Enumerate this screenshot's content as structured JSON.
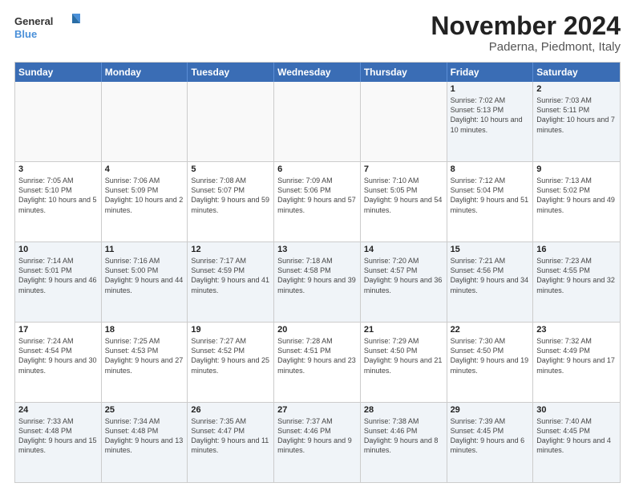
{
  "logo": {
    "line1": "General",
    "line2": "Blue"
  },
  "title": "November 2024",
  "subtitle": "Paderna, Piedmont, Italy",
  "headers": [
    "Sunday",
    "Monday",
    "Tuesday",
    "Wednesday",
    "Thursday",
    "Friday",
    "Saturday"
  ],
  "rows": [
    [
      {
        "day": "",
        "text": ""
      },
      {
        "day": "",
        "text": ""
      },
      {
        "day": "",
        "text": ""
      },
      {
        "day": "",
        "text": ""
      },
      {
        "day": "",
        "text": ""
      },
      {
        "day": "1",
        "text": "Sunrise: 7:02 AM\nSunset: 5:13 PM\nDaylight: 10 hours and 10 minutes."
      },
      {
        "day": "2",
        "text": "Sunrise: 7:03 AM\nSunset: 5:11 PM\nDaylight: 10 hours and 7 minutes."
      }
    ],
    [
      {
        "day": "3",
        "text": "Sunrise: 7:05 AM\nSunset: 5:10 PM\nDaylight: 10 hours and 5 minutes."
      },
      {
        "day": "4",
        "text": "Sunrise: 7:06 AM\nSunset: 5:09 PM\nDaylight: 10 hours and 2 minutes."
      },
      {
        "day": "5",
        "text": "Sunrise: 7:08 AM\nSunset: 5:07 PM\nDaylight: 9 hours and 59 minutes."
      },
      {
        "day": "6",
        "text": "Sunrise: 7:09 AM\nSunset: 5:06 PM\nDaylight: 9 hours and 57 minutes."
      },
      {
        "day": "7",
        "text": "Sunrise: 7:10 AM\nSunset: 5:05 PM\nDaylight: 9 hours and 54 minutes."
      },
      {
        "day": "8",
        "text": "Sunrise: 7:12 AM\nSunset: 5:04 PM\nDaylight: 9 hours and 51 minutes."
      },
      {
        "day": "9",
        "text": "Sunrise: 7:13 AM\nSunset: 5:02 PM\nDaylight: 9 hours and 49 minutes."
      }
    ],
    [
      {
        "day": "10",
        "text": "Sunrise: 7:14 AM\nSunset: 5:01 PM\nDaylight: 9 hours and 46 minutes."
      },
      {
        "day": "11",
        "text": "Sunrise: 7:16 AM\nSunset: 5:00 PM\nDaylight: 9 hours and 44 minutes."
      },
      {
        "day": "12",
        "text": "Sunrise: 7:17 AM\nSunset: 4:59 PM\nDaylight: 9 hours and 41 minutes."
      },
      {
        "day": "13",
        "text": "Sunrise: 7:18 AM\nSunset: 4:58 PM\nDaylight: 9 hours and 39 minutes."
      },
      {
        "day": "14",
        "text": "Sunrise: 7:20 AM\nSunset: 4:57 PM\nDaylight: 9 hours and 36 minutes."
      },
      {
        "day": "15",
        "text": "Sunrise: 7:21 AM\nSunset: 4:56 PM\nDaylight: 9 hours and 34 minutes."
      },
      {
        "day": "16",
        "text": "Sunrise: 7:23 AM\nSunset: 4:55 PM\nDaylight: 9 hours and 32 minutes."
      }
    ],
    [
      {
        "day": "17",
        "text": "Sunrise: 7:24 AM\nSunset: 4:54 PM\nDaylight: 9 hours and 30 minutes."
      },
      {
        "day": "18",
        "text": "Sunrise: 7:25 AM\nSunset: 4:53 PM\nDaylight: 9 hours and 27 minutes."
      },
      {
        "day": "19",
        "text": "Sunrise: 7:27 AM\nSunset: 4:52 PM\nDaylight: 9 hours and 25 minutes."
      },
      {
        "day": "20",
        "text": "Sunrise: 7:28 AM\nSunset: 4:51 PM\nDaylight: 9 hours and 23 minutes."
      },
      {
        "day": "21",
        "text": "Sunrise: 7:29 AM\nSunset: 4:50 PM\nDaylight: 9 hours and 21 minutes."
      },
      {
        "day": "22",
        "text": "Sunrise: 7:30 AM\nSunset: 4:50 PM\nDaylight: 9 hours and 19 minutes."
      },
      {
        "day": "23",
        "text": "Sunrise: 7:32 AM\nSunset: 4:49 PM\nDaylight: 9 hours and 17 minutes."
      }
    ],
    [
      {
        "day": "24",
        "text": "Sunrise: 7:33 AM\nSunset: 4:48 PM\nDaylight: 9 hours and 15 minutes."
      },
      {
        "day": "25",
        "text": "Sunrise: 7:34 AM\nSunset: 4:48 PM\nDaylight: 9 hours and 13 minutes."
      },
      {
        "day": "26",
        "text": "Sunrise: 7:35 AM\nSunset: 4:47 PM\nDaylight: 9 hours and 11 minutes."
      },
      {
        "day": "27",
        "text": "Sunrise: 7:37 AM\nSunset: 4:46 PM\nDaylight: 9 hours and 9 minutes."
      },
      {
        "day": "28",
        "text": "Sunrise: 7:38 AM\nSunset: 4:46 PM\nDaylight: 9 hours and 8 minutes."
      },
      {
        "day": "29",
        "text": "Sunrise: 7:39 AM\nSunset: 4:45 PM\nDaylight: 9 hours and 6 minutes."
      },
      {
        "day": "30",
        "text": "Sunrise: 7:40 AM\nSunset: 4:45 PM\nDaylight: 9 hours and 4 minutes."
      }
    ]
  ]
}
